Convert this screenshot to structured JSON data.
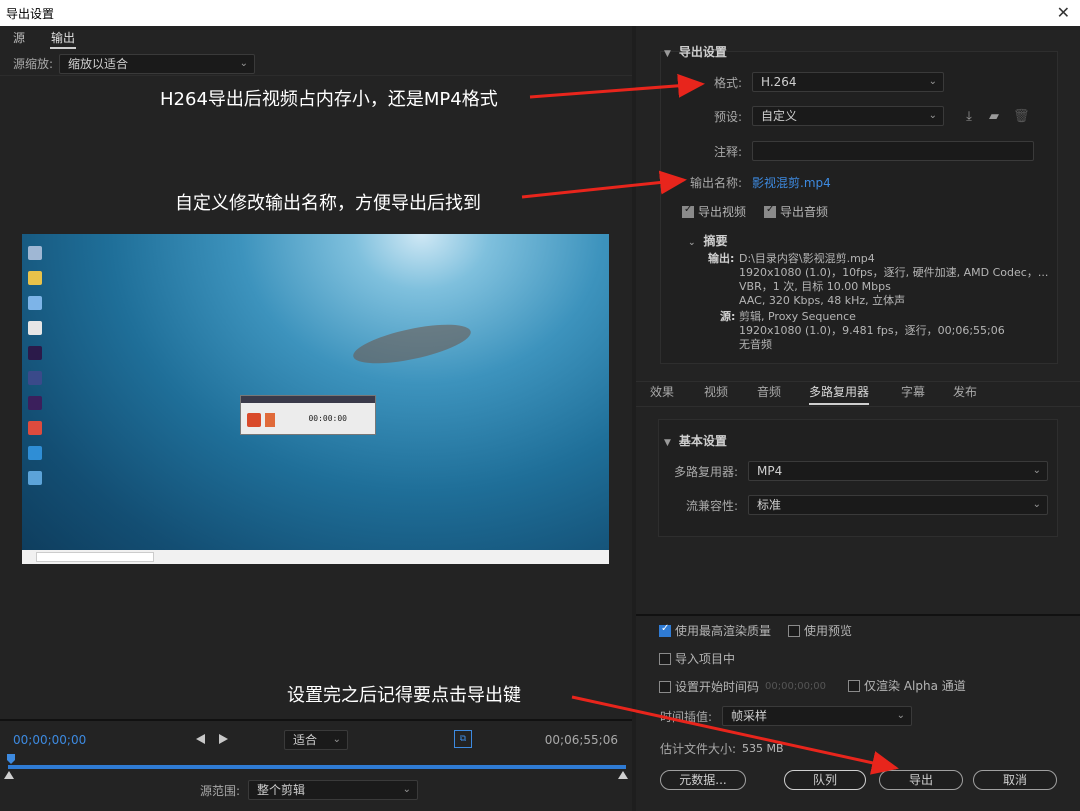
{
  "window": {
    "title": "导出设置",
    "close_glyph": "✕"
  },
  "left": {
    "tabs": [
      {
        "label": "源"
      },
      {
        "label": "输出"
      }
    ],
    "scale_label": "源缩放:",
    "scale_value": "缩放以适合",
    "timeline": {
      "start_tc": "00;00;00;00",
      "end_tc": "00;06;55;06",
      "fit_value": "适合",
      "range_label": "源范围:",
      "range_value": "整个剪辑"
    },
    "recorder": {
      "time": "00:00:00"
    }
  },
  "right": {
    "export_settings": {
      "heading": "导出设置",
      "format_label": "格式:",
      "format_value": "H.264",
      "preset_label": "预设:",
      "preset_value": "自定义",
      "comment_label": "注释:",
      "comment_value": "",
      "output_name_label": "输出名称:",
      "output_name_value": "影视混剪.mp4",
      "export_video": "导出视频",
      "export_audio": "导出音频",
      "summary_heading": "摘要",
      "output_key": "输出:",
      "output_lines": [
        "D:\\目录内容\\影视混剪.mp4",
        "1920x1080 (1.0)，10fps，逐行, 硬件加速, AMD Codec，...",
        "VBR，1 次, 目标 10.00 Mbps",
        "AAC, 320 Kbps, 48  kHz, 立体声"
      ],
      "source_key": "源:",
      "source_lines": [
        "剪辑, Proxy Sequence",
        "1920x1080 (1.0)，9.481 fps，逐行，00;06;55;06",
        "无音频"
      ]
    },
    "tabs": [
      "效果",
      "视频",
      "音频",
      "多路复用器",
      "字幕",
      "发布"
    ],
    "basic": {
      "heading": "基本设置",
      "mux_label": "多路复用器:",
      "mux_value": "MP4",
      "compat_label": "流兼容性:",
      "compat_value": "标准"
    },
    "bottom": {
      "max_quality": "使用最高渲染质量",
      "use_preview": "使用预览",
      "import_project": "导入项目中",
      "set_start_tc": "设置开始时间码",
      "start_tc_value": "00;00;00;00",
      "alpha_only": "仅渲染 Alpha 通道",
      "interp_label": "时间插值:",
      "interp_value": "帧采样",
      "est_size_label": "估计文件大小:",
      "est_size_value": "535 MB",
      "metadata_btn": "元数据...",
      "queue_btn": "队列",
      "export_btn": "导出",
      "cancel_btn": "取消"
    }
  },
  "annotations": {
    "a1": "H264导出后视频占内存小，还是MP4格式",
    "a2": "自定义修改输出名称，方便导出后找到",
    "a3": "设置完之后记得要点击导出键",
    "arrow_color": "#e8251c"
  }
}
